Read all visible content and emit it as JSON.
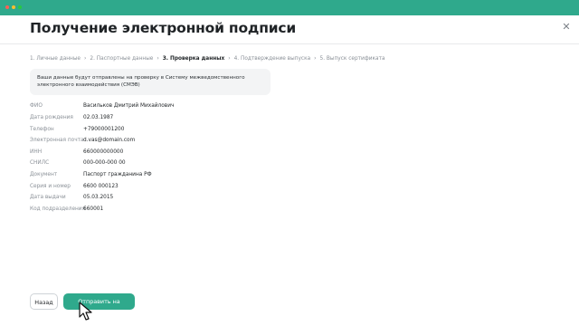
{
  "window": {
    "accent": "#2fa98c",
    "dot_colors": [
      "#ff5f56",
      "#ffbd2e",
      "#27c93f"
    ]
  },
  "page": {
    "title": "Получение электронной подписи",
    "close_icon": "close-icon"
  },
  "steps": [
    {
      "label": "1. Личные данные"
    },
    {
      "label": "2. Паспортные данные"
    },
    {
      "label": "3. Проверка данных"
    },
    {
      "label": "4. Подтверждение выпуска"
    },
    {
      "label": "5. Выпуск сертификата"
    }
  ],
  "info": {
    "text": "Ваши данные будут отправлены на проверку в Систему межведомственного электронного взаимодействия (СМЭВ)"
  },
  "fields": [
    {
      "label": "ФИО",
      "value": "Васильков Дмитрий Михайлович"
    },
    {
      "label": "Дата рождения",
      "value": "02.03.1987"
    },
    {
      "label": "Телефон",
      "value": "+79000001200"
    },
    {
      "label": "Электронная почта",
      "value": "d.vas@domain.com"
    },
    {
      "label": "ИНН",
      "value": "660000000000"
    },
    {
      "label": "СНИЛС",
      "value": "000-000-000 00"
    },
    {
      "label": "Документ",
      "value": "Паспорт гражданина РФ"
    },
    {
      "label": "Серия и номер",
      "value": "6600 000123"
    },
    {
      "label": "Дата выдачи",
      "value": "05.03.2015"
    },
    {
      "label": "Код подразделения",
      "value": "660001"
    }
  ],
  "buttons": {
    "back": "Назад",
    "submit": "Отправить на проверку"
  }
}
